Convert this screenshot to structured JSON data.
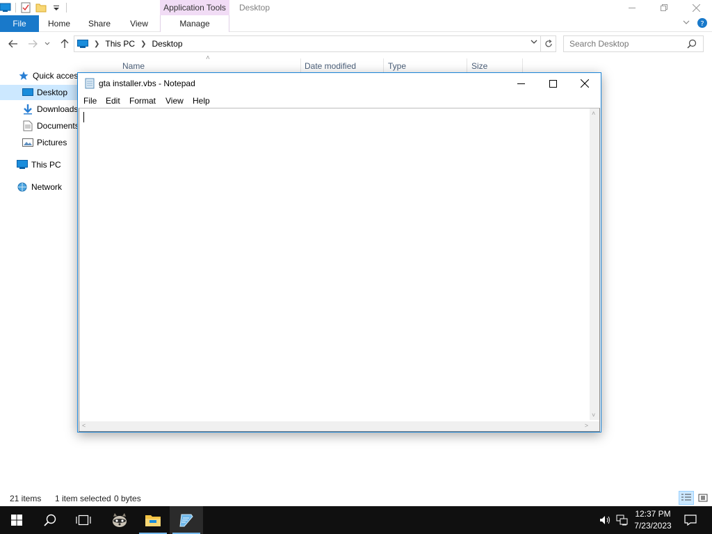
{
  "explorer": {
    "context_tab": "Application Tools",
    "window_title": "Desktop",
    "ribbon_tabs": {
      "file": "File",
      "home": "Home",
      "share": "Share",
      "view": "View",
      "manage": "Manage"
    },
    "breadcrumb": {
      "this_pc": "This PC",
      "desktop": "Desktop"
    },
    "search_placeholder": "Search Desktop",
    "columns": {
      "name": "Name",
      "date_modified": "Date modified",
      "type": "Type",
      "size": "Size"
    },
    "nav": {
      "quick_access": "Quick access",
      "desktop": "Desktop",
      "downloads": "Downloads",
      "documents": "Documents",
      "pictures": "Pictures",
      "this_pc": "This PC",
      "network": "Network"
    },
    "status": {
      "item_count": "21 items",
      "selection": "1 item selected",
      "size": "0 bytes"
    }
  },
  "notepad": {
    "title": "gta installer.vbs - Notepad",
    "menu": {
      "file": "File",
      "edit": "Edit",
      "format": "Format",
      "view": "View",
      "help": "Help"
    },
    "content": ""
  },
  "taskbar": {
    "time": "12:37 PM",
    "date": "7/23/2023",
    "icons": [
      "start-icon",
      "search-icon",
      "task-view-icon",
      "raccoon-app-icon",
      "file-explorer-icon",
      "notepad-icon",
      "volume-icon",
      "network-icon",
      "notifications-icon"
    ]
  },
  "colors": {
    "accent": "#1979ca",
    "selection": "#cce8ff",
    "context_tab": "#f1dcf5",
    "taskbar": "#101010"
  }
}
